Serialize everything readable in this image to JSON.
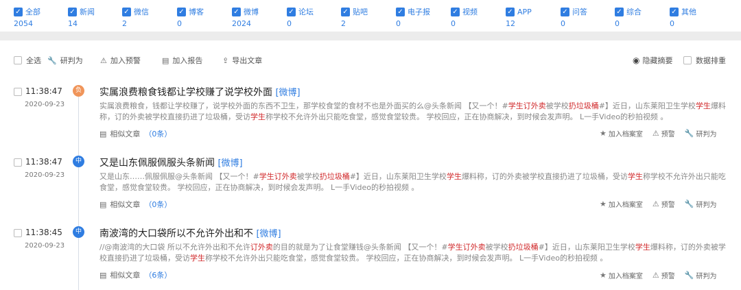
{
  "filters": [
    {
      "label": "全部",
      "count": "2054"
    },
    {
      "label": "新闻",
      "count": "14"
    },
    {
      "label": "微信",
      "count": "2"
    },
    {
      "label": "博客",
      "count": "0"
    },
    {
      "label": "微博",
      "count": "2024"
    },
    {
      "label": "论坛",
      "count": "0"
    },
    {
      "label": "贴吧",
      "count": "2"
    },
    {
      "label": "电子报",
      "count": "0"
    },
    {
      "label": "视频",
      "count": "0"
    },
    {
      "label": "APP",
      "count": "12"
    },
    {
      "label": "问答",
      "count": "0"
    },
    {
      "label": "综合",
      "count": "0"
    },
    {
      "label": "其他",
      "count": "0"
    }
  ],
  "toolbar": {
    "select_all": "全选",
    "judge": "研判为",
    "add_warning": "加入预警",
    "add_report": "加入报告",
    "export": "导出文章",
    "hide_summary": "隐藏摘要",
    "data_dedup": "数据排重"
  },
  "icons": {
    "check": "✓",
    "wrench": "🔧",
    "bell": "⚠",
    "report": "▤",
    "export": "⇪",
    "eye": "◉",
    "star": "★",
    "doc": "▤"
  },
  "colors": {
    "accent": "#2f7de1",
    "negative": "#f0955a",
    "highlight": "#d0282a"
  },
  "articles": [
    {
      "time": "11:38:47",
      "date": "2020-09-23",
      "sentiment": "负",
      "title": "实属浪费粮食钱都让学校赚了说学校外面",
      "source": "[微博]",
      "snippet_parts": [
        {
          "t": "实属浪费粮食，钱都让学校赚了，说学校外面的东西不卫生，那学校食堂的食材不也是外面买的么@头条新闻 【又一个！#"
        },
        {
          "t": "学生订外卖",
          "hl": true
        },
        {
          "t": "被学校"
        },
        {
          "t": "扔垃圾桶",
          "hl": true
        },
        {
          "t": "#】近日，山东莱阳卫生学校"
        },
        {
          "t": "学生",
          "hl": true
        },
        {
          "t": "爆料称，订的外卖被学校直接扔进了垃圾桶，受访"
        },
        {
          "t": "学生",
          "hl": true
        },
        {
          "t": "称学校不允许外出只能吃食堂，感觉食堂较贵。 学校回应，正在协商解决，到时候会发声明。 L一手Video的秒拍视频 。"
        }
      ],
      "similar_label": "相似文章",
      "similar_count": "（0条）",
      "actions": [
        "加入档案室",
        "预警",
        "研判为"
      ]
    },
    {
      "time": "11:38:47",
      "date": "2020-09-23",
      "sentiment": "中",
      "title": "又是山东佩服佩服头条新闻",
      "source": "[微博]",
      "snippet_parts": [
        {
          "t": "又是山东……佩服佩服@头条新闻 【又一个！#"
        },
        {
          "t": "学生订外卖",
          "hl": true
        },
        {
          "t": "被学校"
        },
        {
          "t": "扔垃圾桶",
          "hl": true
        },
        {
          "t": "#】近日，山东莱阳卫生学校"
        },
        {
          "t": "学生",
          "hl": true
        },
        {
          "t": "爆料称，订的外卖被学校直接扔进了垃圾桶，受访"
        },
        {
          "t": "学生",
          "hl": true
        },
        {
          "t": "称学校不允许外出只能吃食堂，感觉食堂较贵。 学校回应，正在协商解决，到时候会发声明。 L一手Video的秒拍视频 。"
        }
      ],
      "similar_label": "相似文章",
      "similar_count": "（0条）",
      "actions": [
        "加入档案室",
        "预警",
        "研判为"
      ]
    },
    {
      "time": "11:38:45",
      "date": "2020-09-23",
      "sentiment": "中",
      "title": "南波湾的大口袋所以不允许外出和不",
      "source": "[微博]",
      "snippet_parts": [
        {
          "t": "//@南波湾的大口袋 所以不允许外出和不允许"
        },
        {
          "t": "订外卖",
          "hl": true
        },
        {
          "t": "的目的就是为了让食堂赚钱@头条新闻 【又一个！#"
        },
        {
          "t": "学生订外卖",
          "hl": true
        },
        {
          "t": "被学校"
        },
        {
          "t": "扔垃圾桶",
          "hl": true
        },
        {
          "t": "#】近日，山东莱阳卫生学校"
        },
        {
          "t": "学生",
          "hl": true
        },
        {
          "t": "爆料称，订的外卖被学校直接扔进了垃圾桶，受访"
        },
        {
          "t": "学生",
          "hl": true
        },
        {
          "t": "称学校不允许外出只能吃食堂，感觉食堂较贵。 学校回应，正在协商解决，到时候会发声明。 L一手Video的秒拍视频 。"
        }
      ],
      "similar_label": "相似文章",
      "similar_count": "（6条）",
      "actions": [
        "加入档案室",
        "预警",
        "研判为"
      ]
    }
  ]
}
